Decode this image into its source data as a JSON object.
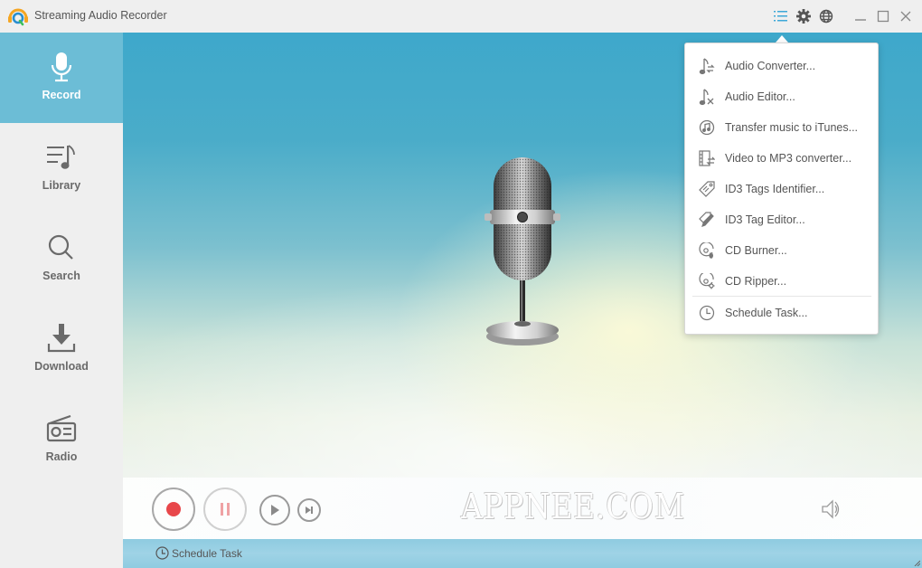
{
  "titlebar": {
    "app_title": "Streaming Audio Recorder",
    "icons": [
      "menu-list-icon",
      "gear-icon",
      "globe-icon",
      "minimize-icon",
      "maximize-icon",
      "close-icon"
    ],
    "accent_color": "#3ea8cb"
  },
  "sidebar": {
    "active_color": "#6cbdd6",
    "items": [
      {
        "label": "Record",
        "icon": "microphone-icon",
        "active": true
      },
      {
        "label": "Library",
        "icon": "music-list-icon",
        "active": false
      },
      {
        "label": "Search",
        "icon": "search-icon",
        "active": false
      },
      {
        "label": "Download",
        "icon": "download-icon",
        "active": false
      },
      {
        "label": "Radio",
        "icon": "radio-icon",
        "active": false
      }
    ]
  },
  "main": {
    "watermark": "APPNEE.COM",
    "controls": {
      "record": "record-icon",
      "pause": "pause-icon",
      "play": "play-icon",
      "next": "skip-next-icon",
      "volume": "speaker-icon",
      "record_color": "#e8474a"
    },
    "schedule_task_label": "Schedule Task"
  },
  "menu": {
    "items": [
      {
        "label": "Audio Converter...",
        "icon": "audio-convert-icon"
      },
      {
        "label": "Audio Editor...",
        "icon": "audio-edit-icon"
      },
      {
        "label": "Transfer music to iTunes...",
        "icon": "music-note-circle-icon"
      },
      {
        "label": "Video to MP3 converter...",
        "icon": "film-convert-icon"
      },
      {
        "label": "ID3 Tags Identifier...",
        "icon": "tag-icon"
      },
      {
        "label": "ID3 Tag Editor...",
        "icon": "tag-pencil-icon"
      },
      {
        "label": "CD Burner...",
        "icon": "cd-burn-icon"
      },
      {
        "label": "CD Ripper...",
        "icon": "cd-rip-icon"
      }
    ],
    "footer_item": {
      "label": "Schedule Task...",
      "icon": "clock-icon"
    }
  }
}
